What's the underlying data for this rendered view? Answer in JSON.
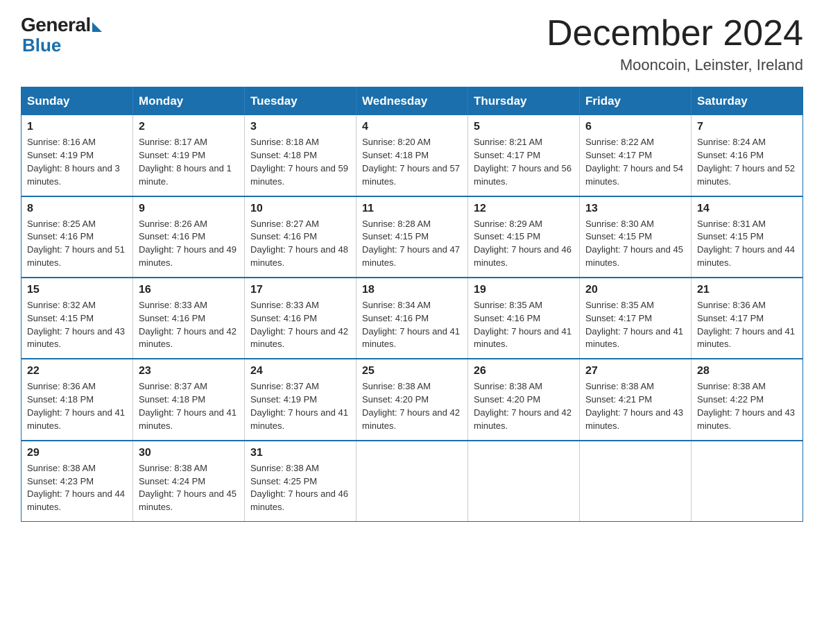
{
  "logo": {
    "general": "General",
    "blue": "Blue"
  },
  "header": {
    "month_year": "December 2024",
    "location": "Mooncoin, Leinster, Ireland"
  },
  "days_of_week": [
    "Sunday",
    "Monday",
    "Tuesday",
    "Wednesday",
    "Thursday",
    "Friday",
    "Saturday"
  ],
  "weeks": [
    [
      {
        "day": "1",
        "sunrise": "8:16 AM",
        "sunset": "4:19 PM",
        "daylight": "8 hours and 3 minutes."
      },
      {
        "day": "2",
        "sunrise": "8:17 AM",
        "sunset": "4:19 PM",
        "daylight": "8 hours and 1 minute."
      },
      {
        "day": "3",
        "sunrise": "8:18 AM",
        "sunset": "4:18 PM",
        "daylight": "7 hours and 59 minutes."
      },
      {
        "day": "4",
        "sunrise": "8:20 AM",
        "sunset": "4:18 PM",
        "daylight": "7 hours and 57 minutes."
      },
      {
        "day": "5",
        "sunrise": "8:21 AM",
        "sunset": "4:17 PM",
        "daylight": "7 hours and 56 minutes."
      },
      {
        "day": "6",
        "sunrise": "8:22 AM",
        "sunset": "4:17 PM",
        "daylight": "7 hours and 54 minutes."
      },
      {
        "day": "7",
        "sunrise": "8:24 AM",
        "sunset": "4:16 PM",
        "daylight": "7 hours and 52 minutes."
      }
    ],
    [
      {
        "day": "8",
        "sunrise": "8:25 AM",
        "sunset": "4:16 PM",
        "daylight": "7 hours and 51 minutes."
      },
      {
        "day": "9",
        "sunrise": "8:26 AM",
        "sunset": "4:16 PM",
        "daylight": "7 hours and 49 minutes."
      },
      {
        "day": "10",
        "sunrise": "8:27 AM",
        "sunset": "4:16 PM",
        "daylight": "7 hours and 48 minutes."
      },
      {
        "day": "11",
        "sunrise": "8:28 AM",
        "sunset": "4:15 PM",
        "daylight": "7 hours and 47 minutes."
      },
      {
        "day": "12",
        "sunrise": "8:29 AM",
        "sunset": "4:15 PM",
        "daylight": "7 hours and 46 minutes."
      },
      {
        "day": "13",
        "sunrise": "8:30 AM",
        "sunset": "4:15 PM",
        "daylight": "7 hours and 45 minutes."
      },
      {
        "day": "14",
        "sunrise": "8:31 AM",
        "sunset": "4:15 PM",
        "daylight": "7 hours and 44 minutes."
      }
    ],
    [
      {
        "day": "15",
        "sunrise": "8:32 AM",
        "sunset": "4:15 PM",
        "daylight": "7 hours and 43 minutes."
      },
      {
        "day": "16",
        "sunrise": "8:33 AM",
        "sunset": "4:16 PM",
        "daylight": "7 hours and 42 minutes."
      },
      {
        "day": "17",
        "sunrise": "8:33 AM",
        "sunset": "4:16 PM",
        "daylight": "7 hours and 42 minutes."
      },
      {
        "day": "18",
        "sunrise": "8:34 AM",
        "sunset": "4:16 PM",
        "daylight": "7 hours and 41 minutes."
      },
      {
        "day": "19",
        "sunrise": "8:35 AM",
        "sunset": "4:16 PM",
        "daylight": "7 hours and 41 minutes."
      },
      {
        "day": "20",
        "sunrise": "8:35 AM",
        "sunset": "4:17 PM",
        "daylight": "7 hours and 41 minutes."
      },
      {
        "day": "21",
        "sunrise": "8:36 AM",
        "sunset": "4:17 PM",
        "daylight": "7 hours and 41 minutes."
      }
    ],
    [
      {
        "day": "22",
        "sunrise": "8:36 AM",
        "sunset": "4:18 PM",
        "daylight": "7 hours and 41 minutes."
      },
      {
        "day": "23",
        "sunrise": "8:37 AM",
        "sunset": "4:18 PM",
        "daylight": "7 hours and 41 minutes."
      },
      {
        "day": "24",
        "sunrise": "8:37 AM",
        "sunset": "4:19 PM",
        "daylight": "7 hours and 41 minutes."
      },
      {
        "day": "25",
        "sunrise": "8:38 AM",
        "sunset": "4:20 PM",
        "daylight": "7 hours and 42 minutes."
      },
      {
        "day": "26",
        "sunrise": "8:38 AM",
        "sunset": "4:20 PM",
        "daylight": "7 hours and 42 minutes."
      },
      {
        "day": "27",
        "sunrise": "8:38 AM",
        "sunset": "4:21 PM",
        "daylight": "7 hours and 43 minutes."
      },
      {
        "day": "28",
        "sunrise": "8:38 AM",
        "sunset": "4:22 PM",
        "daylight": "7 hours and 43 minutes."
      }
    ],
    [
      {
        "day": "29",
        "sunrise": "8:38 AM",
        "sunset": "4:23 PM",
        "daylight": "7 hours and 44 minutes."
      },
      {
        "day": "30",
        "sunrise": "8:38 AM",
        "sunset": "4:24 PM",
        "daylight": "7 hours and 45 minutes."
      },
      {
        "day": "31",
        "sunrise": "8:38 AM",
        "sunset": "4:25 PM",
        "daylight": "7 hours and 46 minutes."
      },
      null,
      null,
      null,
      null
    ]
  ]
}
